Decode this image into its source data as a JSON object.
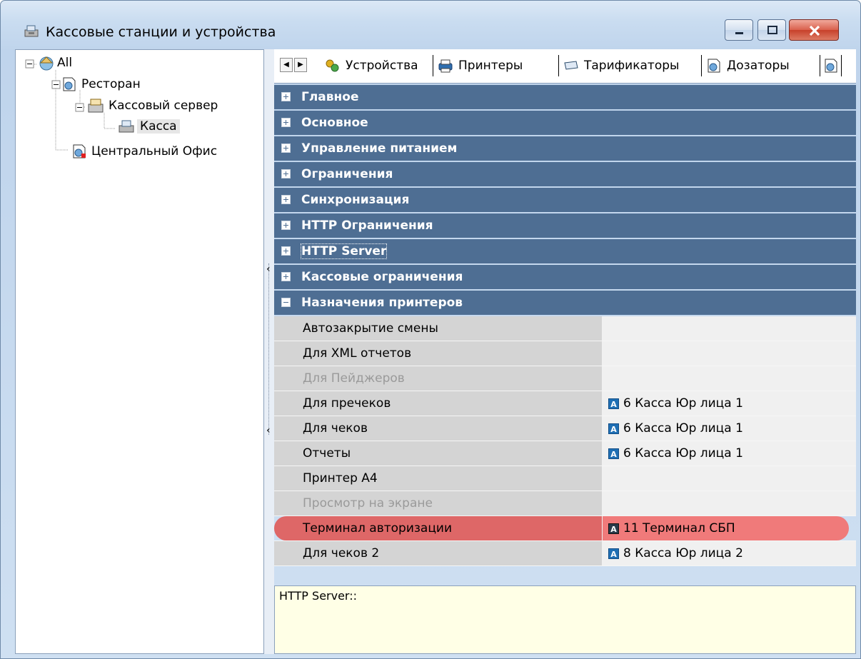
{
  "window": {
    "title": "Кассовые станции и устройства",
    "icon": "cash-register-icon"
  },
  "tree": {
    "nodes": [
      {
        "label": "All",
        "icon": "globe-house-icon",
        "expanded": true
      },
      {
        "label": "Ресторан",
        "icon": "restaurant-icon",
        "expanded": true
      },
      {
        "label": "Кассовый сервер",
        "icon": "server-icon",
        "expanded": true
      },
      {
        "label": "Касса",
        "icon": "cash-register-icon",
        "selected": true
      },
      {
        "label": "Центральный Офис",
        "icon": "office-icon"
      }
    ]
  },
  "tabs": [
    {
      "label": "Устройства",
      "icon": "devices-icon"
    },
    {
      "label": "Принтеры",
      "icon": "printer-icon"
    },
    {
      "label": "Тарификаторы",
      "icon": "tariff-icon"
    },
    {
      "label": "Дозаторы",
      "icon": "dispenser-icon"
    }
  ],
  "categories": [
    {
      "label": "Главное",
      "expanded": false
    },
    {
      "label": "Основное",
      "expanded": false
    },
    {
      "label": "Управление питанием",
      "expanded": false
    },
    {
      "label": "Ограничения",
      "expanded": false
    },
    {
      "label": "Синхронизация",
      "expanded": false
    },
    {
      "label": "HTTP Ограничения",
      "expanded": false
    },
    {
      "label": "HTTP Server",
      "expanded": false
    },
    {
      "label": "Кассовые ограничения",
      "expanded": false
    },
    {
      "label": "Назначения принтеров",
      "expanded": true
    }
  ],
  "properties": [
    {
      "name": "Автозакрытие смены",
      "value": "",
      "disabled": false
    },
    {
      "name": "Для XML отчетов",
      "value": "",
      "disabled": false
    },
    {
      "name": "Для Пейджеров",
      "value": "",
      "disabled": true
    },
    {
      "name": "Для пречеков",
      "value": "6 Касса Юр лица 1",
      "badge": "A"
    },
    {
      "name": "Для чеков",
      "value": "6 Касса Юр лица 1",
      "badge": "A"
    },
    {
      "name": "Отчеты",
      "value": "6 Касса Юр лица 1",
      "badge": "A"
    },
    {
      "name": "Принтер А4",
      "value": ""
    },
    {
      "name": "Просмотр на экране",
      "value": "",
      "disabled": true
    },
    {
      "name": "Терминал авторизации",
      "value": "11 Терминал СБП",
      "badge": "A",
      "highlighted": true
    },
    {
      "name": "Для чеков 2",
      "value": "8 Касса Юр лица 2",
      "badge": "A"
    }
  ],
  "description": "HTTP Server::",
  "colors": {
    "category_bg": "#4e6e93",
    "highlight": "#f07a7a",
    "badge": "#1f6fb4",
    "description_bg": "#ffffe6"
  }
}
